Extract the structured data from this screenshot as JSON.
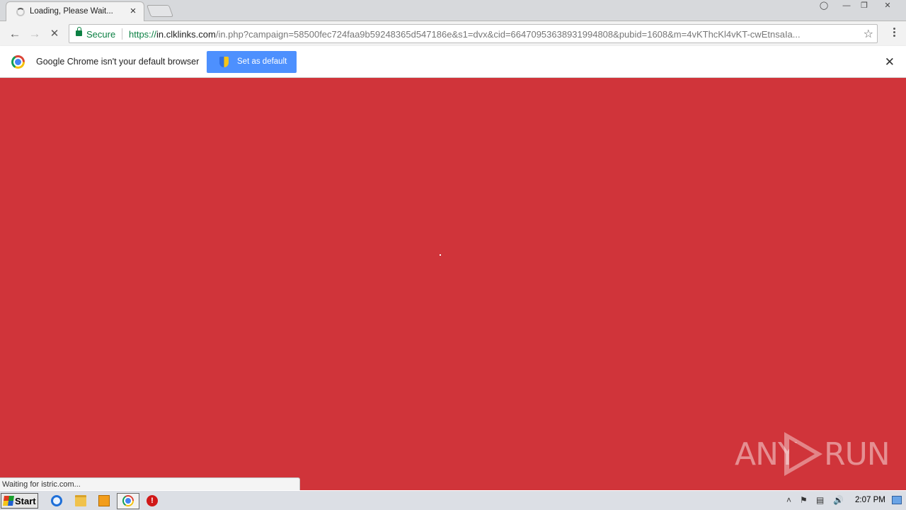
{
  "tabs": [
    {
      "title": "Loading, Please Wait..."
    }
  ],
  "toolbar": {
    "secure_label": "Secure",
    "url_scheme": "https://",
    "url_host": "in.clklinks.com",
    "url_rest": "/in.php?campaign=58500fec724faa9b59248365d547186e&s1=dvx&cid=66470953638931994808&pubid=1608&m=4vKThcKl4vKT-cwEtnsaIa..."
  },
  "infobar": {
    "message": "Google Chrome isn't your default browser",
    "button_label": "Set as default",
    "close_glyph": "✕"
  },
  "content": {
    "status_text": "Waiting for istric.com...",
    "watermark_left": "ANY",
    "watermark_right": "RUN",
    "background_color": "#d0343a"
  },
  "taskbar": {
    "start_label": "Start",
    "clock": "2:07 PM",
    "pinned": [
      "internet-explorer-icon",
      "explorer-folder-icon",
      "media-player-icon",
      "chrome-icon",
      "stop-icon"
    ]
  }
}
